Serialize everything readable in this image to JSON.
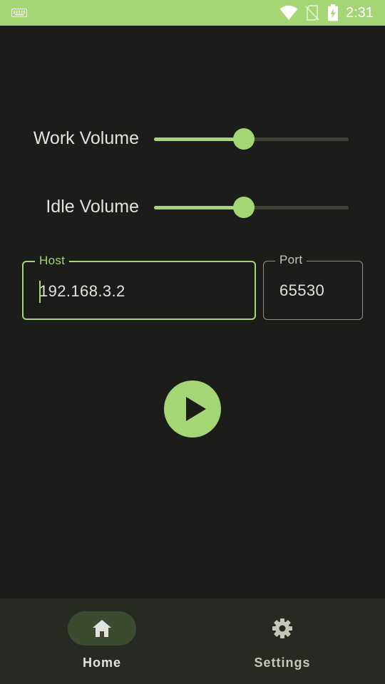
{
  "status_bar": {
    "time": "2:31",
    "icons": [
      "keyboard-icon",
      "wifi-icon",
      "no-sim-icon",
      "battery-charging-icon"
    ]
  },
  "controls": {
    "work_volume": {
      "label": "Work Volume",
      "value_fraction": 0.46
    },
    "idle_volume": {
      "label": "Idle Volume",
      "value_fraction": 0.46
    }
  },
  "connection": {
    "host": {
      "label": "Host",
      "value": "192.168.3.2",
      "focused": true
    },
    "port": {
      "label": "Port",
      "value": "65530"
    }
  },
  "play_button": {
    "icon": "play-icon"
  },
  "bottom_nav": {
    "items": [
      {
        "label": "Home",
        "icon": "home-icon",
        "selected": true
      },
      {
        "label": "Settings",
        "icon": "gear-icon",
        "selected": false
      }
    ]
  },
  "colors": {
    "accent": "#a5d676",
    "background": "#1c1d1a",
    "nav_background": "#272a23",
    "nav_pill": "#3c4b30",
    "text": "#e2e3dc"
  }
}
